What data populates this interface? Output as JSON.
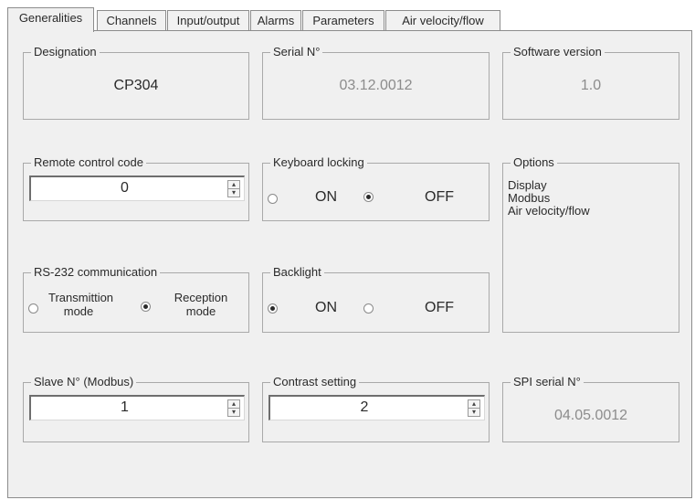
{
  "tabs": [
    {
      "label": "Generalities"
    },
    {
      "label": "Channels"
    },
    {
      "label": "Input/output"
    },
    {
      "label": "Alarms"
    },
    {
      "label": "Parameters"
    },
    {
      "label": "Air velocity/flow"
    }
  ],
  "designation": {
    "label": "Designation",
    "value": "CP304"
  },
  "serial": {
    "label": "Serial N°",
    "value": "03.12.0012"
  },
  "software": {
    "label": "Software version",
    "value": "1.0"
  },
  "remote": {
    "label": "Remote control code",
    "value": "0"
  },
  "keyboard": {
    "label": "Keyboard locking",
    "on_label": "ON",
    "off_label": "OFF",
    "selected": "OFF"
  },
  "options": {
    "label": "Options",
    "items": [
      "Display",
      "Modbus",
      "Air velocity/flow"
    ]
  },
  "rs232": {
    "label": "RS-232 communication",
    "transmission_label": "Transmittion mode",
    "transmission_line1": "Transmittion",
    "transmission_line2": "mode",
    "reception_line1": "Reception",
    "reception_line2": "mode",
    "selected": "Reception mode"
  },
  "backlight": {
    "label": "Backlight",
    "on_label": "ON",
    "off_label": "OFF",
    "selected": "ON"
  },
  "slave": {
    "label": "Slave N° (Modbus)",
    "value": "1"
  },
  "contrast": {
    "label": "Contrast setting",
    "value": "2"
  },
  "spi": {
    "label": "SPI serial N°",
    "value": "04.05.0012"
  }
}
